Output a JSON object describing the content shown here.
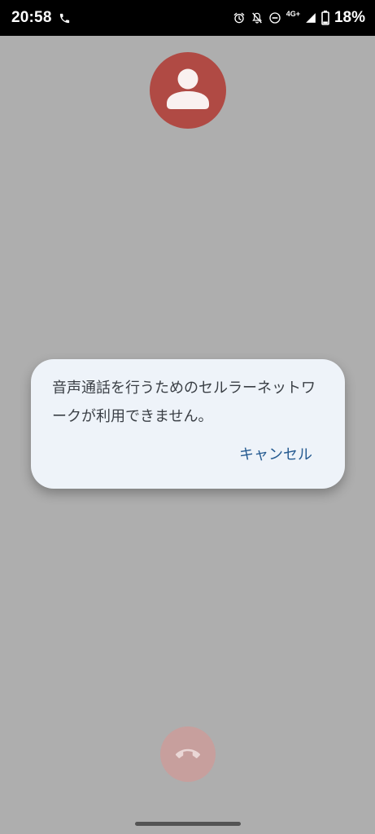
{
  "status_bar": {
    "time": "20:58",
    "network_type": "4G+",
    "battery_percent": "18%",
    "icons": [
      "phone-call-icon",
      "alarm-icon",
      "notifications-off-icon",
      "do-not-disturb-icon",
      "signal-icon",
      "battery-icon"
    ]
  },
  "call_screen": {
    "avatar_icon": "person-icon",
    "avatar_color": "#b04a44",
    "end_call_icon": "call-end-icon",
    "end_call_color": "#c79f9d"
  },
  "dialog": {
    "message": "音声通話を行うためのセルラーネットワークが利用できません。",
    "cancel_label": "キャンセル",
    "accent_color": "#265b91"
  }
}
